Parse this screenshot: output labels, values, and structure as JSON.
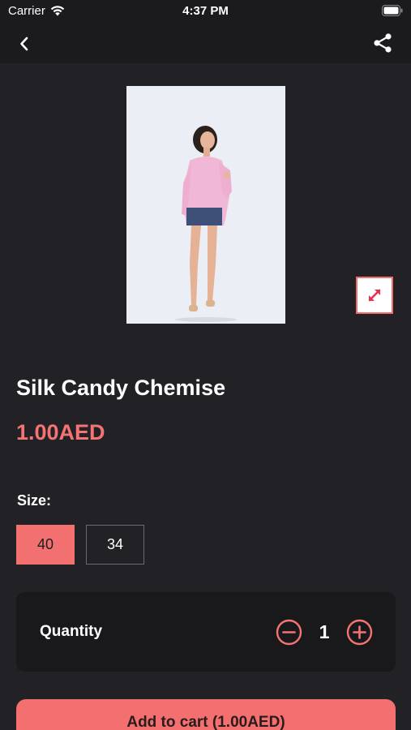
{
  "status_bar": {
    "carrier": "Carrier",
    "time": "4:37 PM",
    "icons": [
      "wifi-icon",
      "battery-icon"
    ]
  },
  "nav": {
    "back_icon": "chevron-left-icon",
    "share_icon": "share-icon"
  },
  "product": {
    "title": "Silk Candy Chemise",
    "price": "1.00AED",
    "expand_icon": "expand-icon"
  },
  "size": {
    "label": "Size:",
    "options": [
      {
        "label": "40",
        "selected": true
      },
      {
        "label": "34",
        "selected": false
      }
    ]
  },
  "quantity": {
    "label": "Quantity",
    "value": "1",
    "decrease_icon": "minus-circle-icon",
    "increase_icon": "plus-circle-icon"
  },
  "cart": {
    "button_label": "Add to cart (1.00AED)"
  },
  "colors": {
    "accent": "#f47474",
    "background": "#222226",
    "card": "#19191c"
  }
}
